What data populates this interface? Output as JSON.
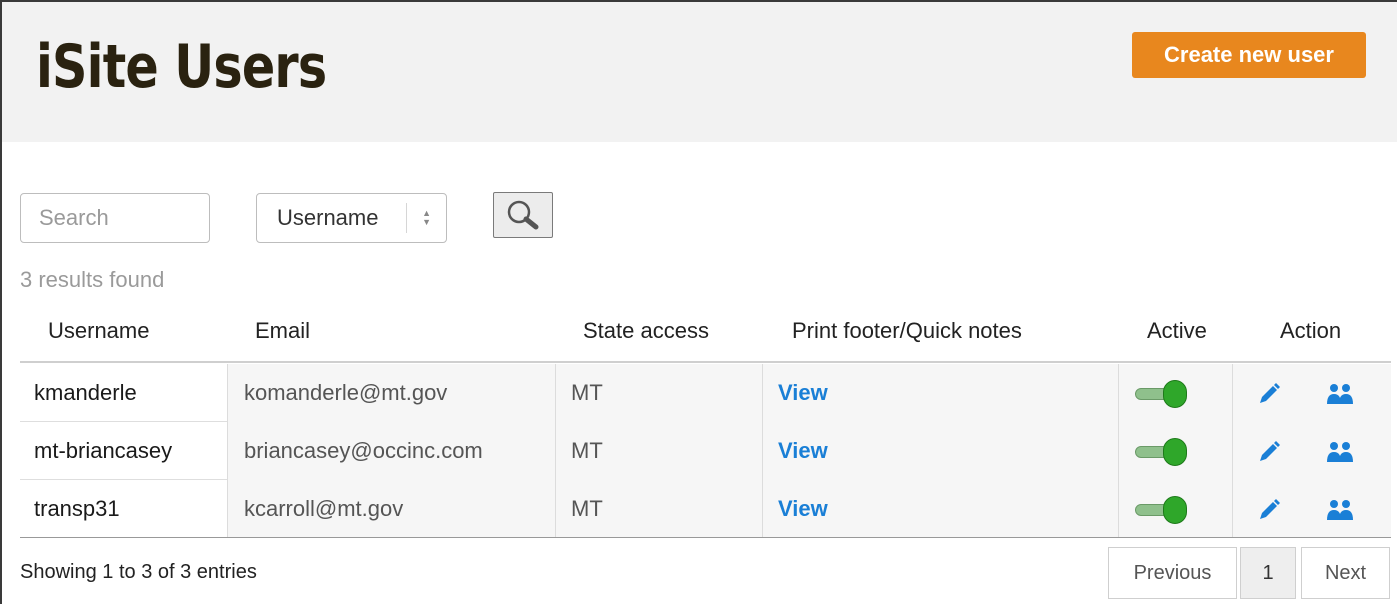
{
  "header": {
    "title": "iSite Users",
    "create_button_label": "Create new user"
  },
  "search": {
    "placeholder": "Search",
    "value": "",
    "field_select_value": "Username",
    "search_icon": "search-icon"
  },
  "results": {
    "count_text": "3 results found"
  },
  "table": {
    "columns": [
      "Username",
      "Email",
      "State access",
      "Print footer/Quick notes",
      "Active",
      "Action"
    ],
    "rows": [
      {
        "username": "kmanderle",
        "email": "komanderle@mt.gov",
        "state": "MT",
        "notes_link": "View",
        "active": true
      },
      {
        "username": "mt-briancasey",
        "email": "briancasey@occinc.com",
        "state": "MT",
        "notes_link": "View",
        "active": true
      },
      {
        "username": "transp31",
        "email": "kcarroll@mt.gov",
        "state": "MT",
        "notes_link": "View",
        "active": true
      }
    ],
    "action_icons": [
      "pencil-icon",
      "users-icon"
    ]
  },
  "footer": {
    "showing_text": "Showing 1 to 3 of 3 entries",
    "previous_label": "Previous",
    "current_page": "1",
    "next_label": "Next"
  },
  "colors": {
    "accent": "#e8871e",
    "link": "#1a7fd6",
    "toggle_on": "#2fa72a"
  }
}
